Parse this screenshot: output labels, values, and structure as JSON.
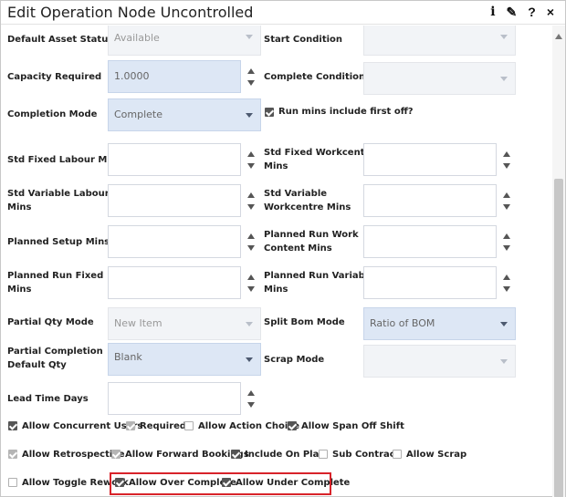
{
  "title": "Edit Operation Node Uncontrolled",
  "toolbar": {
    "info": "i",
    "edit": "✎",
    "help": "?",
    "close": "×"
  },
  "fields": {
    "default_asset_status": {
      "label": "Default Asset Status",
      "value": "Available"
    },
    "start_condition": {
      "label": "Start Condition",
      "value": ""
    },
    "capacity_required": {
      "label": "Capacity Required",
      "value": "1.0000"
    },
    "complete_condition": {
      "label": "Complete Condition",
      "value": ""
    },
    "completion_mode": {
      "label": "Completion Mode",
      "value": "Complete"
    },
    "run_mins_first_off": {
      "label": "Run mins include first off?",
      "checked": true
    },
    "std_fixed_labour_mins": {
      "label1": "Std Fixed Labour Mins",
      "label2": "",
      "value": ""
    },
    "std_fixed_workcentre_mins": {
      "label1": "Std Fixed Workcentre",
      "label2": "Mins",
      "value": ""
    },
    "std_variable_labour_mins": {
      "label1": "Std Variable Labour",
      "label2": "Mins",
      "value": ""
    },
    "std_variable_workcentre_mins": {
      "label1": "Std Variable",
      "label2": "Workcentre Mins",
      "value": ""
    },
    "planned_setup_mins": {
      "label1": "Planned Setup Mins",
      "label2": "",
      "value": ""
    },
    "planned_run_work_content_mins": {
      "label1": "Planned Run Work",
      "label2": "Content Mins",
      "value": ""
    },
    "planned_run_fixed_mins": {
      "label1": "Planned Run Fixed",
      "label2": "Mins",
      "value": ""
    },
    "planned_run_variable_mins": {
      "label1": "Planned Run Variable",
      "label2": "Mins",
      "value": ""
    },
    "partial_qty_mode": {
      "label": "Partial Qty Mode",
      "value": "New Item"
    },
    "split_bom_mode": {
      "label": "Split Bom Mode",
      "value": "Ratio of BOM"
    },
    "partial_completion_default_qty": {
      "label1": "Partial Completion",
      "label2": "Default Qty",
      "value": "Blank"
    },
    "scrap_mode": {
      "label": "Scrap Mode",
      "value": ""
    },
    "lead_time_days": {
      "label": "Lead Time Days",
      "value": ""
    }
  },
  "checkboxes": {
    "allow_concurrent_users": {
      "label": "Allow Concurrent Users",
      "checked": true
    },
    "required": {
      "label": "Required",
      "checked": true
    },
    "allow_action_choice": {
      "label": "Allow Action Choice",
      "checked": false
    },
    "allow_span_off_shift": {
      "label": "Allow Span Off Shift",
      "checked": true
    },
    "allow_retrospective": {
      "label": "Allow Retrospective",
      "checked": true
    },
    "allow_forward_bookings": {
      "label": "Allow Forward Bookings",
      "checked": true
    },
    "include_on_plan": {
      "label": "Include On Plan",
      "checked": true
    },
    "sub_contract": {
      "label": "Sub Contract",
      "checked": false
    },
    "allow_scrap": {
      "label": "Allow Scrap",
      "checked": false
    },
    "allow_toggle_rework": {
      "label": "Allow Toggle Rework",
      "checked": false
    },
    "allow_over_complete": {
      "label": "Allow Over Complete",
      "checked": true
    },
    "allow_under_complete": {
      "label": "Allow Under Complete",
      "checked": true
    }
  },
  "colors": {
    "highlight": "#d8232a",
    "field_blue": "#dde7f5"
  }
}
